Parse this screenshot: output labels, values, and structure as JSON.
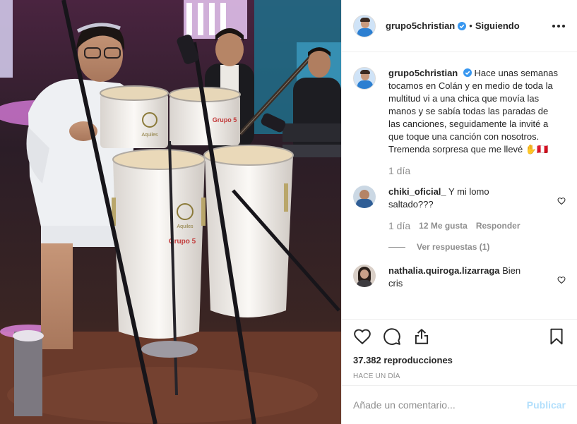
{
  "header": {
    "username": "grupo5christian",
    "separator": "•",
    "follow_status": "Siguiendo"
  },
  "caption": {
    "username": "grupo5christian",
    "text": "Hace unas semanas tocamos en Colán y en medio de toda la multitud vi a una chica que movía las manos y se sabía todas las paradas de las canciones, seguidamente la invité a que toque una canción con nosotros. Tremenda sorpresa que me llevé ✋🇵🇪",
    "time": "1 día"
  },
  "comments": [
    {
      "username": "chiki_oficial_",
      "text": "Y mi lomo saltado???",
      "time": "1 día",
      "likes": "12 Me gusta",
      "reply": "Responder",
      "view_replies": "Ver respuestas (1)"
    },
    {
      "username": "nathalia.quiroga.lizarraga",
      "text": "Bien cris"
    }
  ],
  "stats": {
    "views": "37.382 reproducciones",
    "posted": "Hace un día"
  },
  "add_comment": {
    "placeholder": "Añade un comentario...",
    "publish": "Publicar"
  },
  "media": {
    "brand": "Aquiles",
    "logo_text": "Grupo 5"
  },
  "colors": {
    "verified": "#3897f0",
    "publish_disabled": "#b2dffc",
    "muted": "#8e8e8e"
  }
}
